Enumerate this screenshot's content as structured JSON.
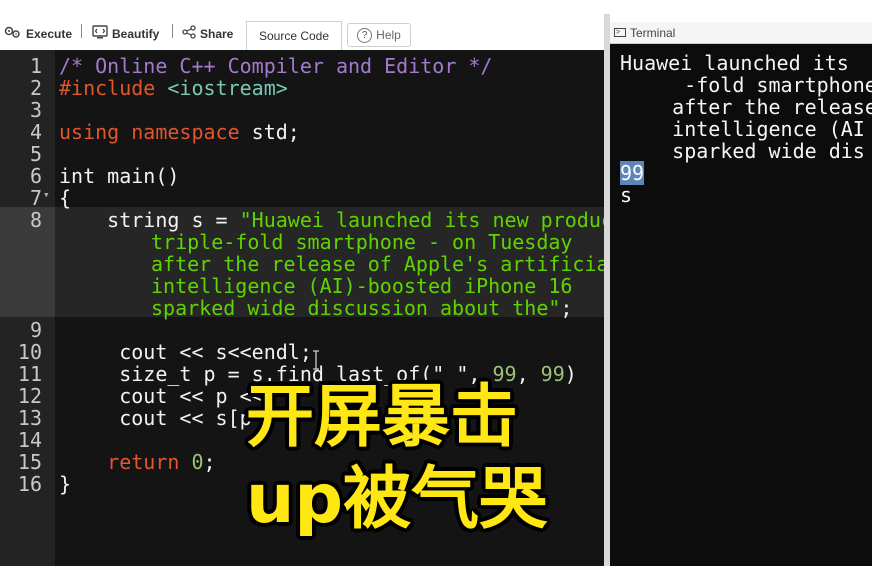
{
  "toolbar": {
    "execute": "Execute",
    "beautify": "Beautify",
    "share": "Share",
    "source_tab": "Source Code",
    "help": "Help"
  },
  "editor": {
    "line_numbers": [
      "1",
      "2",
      "3",
      "4",
      "5",
      "6",
      "7",
      "8",
      "9",
      "10",
      "11",
      "12",
      "13",
      "14",
      "15",
      "16"
    ],
    "lines": {
      "l1": "/* Online C++ Compiler and Editor */",
      "l2a": "#include",
      "l2b": " <iostream>",
      "l4a": "using namespace",
      "l4b": " std;",
      "l6": "int main()",
      "l7": "{",
      "l8a": "    string s = ",
      "l8b": "\"Huawei launched its new product",
      "l8c": "triple-fold smartphone - on Tuesday",
      "l8d": "after the release of Apple's artificial",
      "l8e": "intelligence (AI)-boosted iPhone 16",
      "l8f": "sparked wide discussion about the\"",
      "l8g": ";",
      "l10": "     cout << s<<endl;",
      "l11a": "     size_t p = s.find_last_of(\" \", ",
      "l11b": "99",
      "l11c": ", ",
      "l11d": "99",
      "l11e": ")",
      "l12": "     cout << p <<",
      "l13": "     cout << s[p",
      "l15a": "    return ",
      "l15b": "0",
      "l15c": ";",
      "l16": "}"
    },
    "fold_marker": "▾"
  },
  "terminal": {
    "title": "Terminal",
    "lines": [
      "Huawei launched its",
      "    -fold smartphone",
      "    after the release",
      "    intelligence (AI",
      "    sparked wide dis"
    ],
    "selected_value": "99",
    "last_line": "s"
  },
  "overlay": {
    "line1": "开屏暴击",
    "line2": "up被气哭",
    "color": "#ffe714"
  }
}
